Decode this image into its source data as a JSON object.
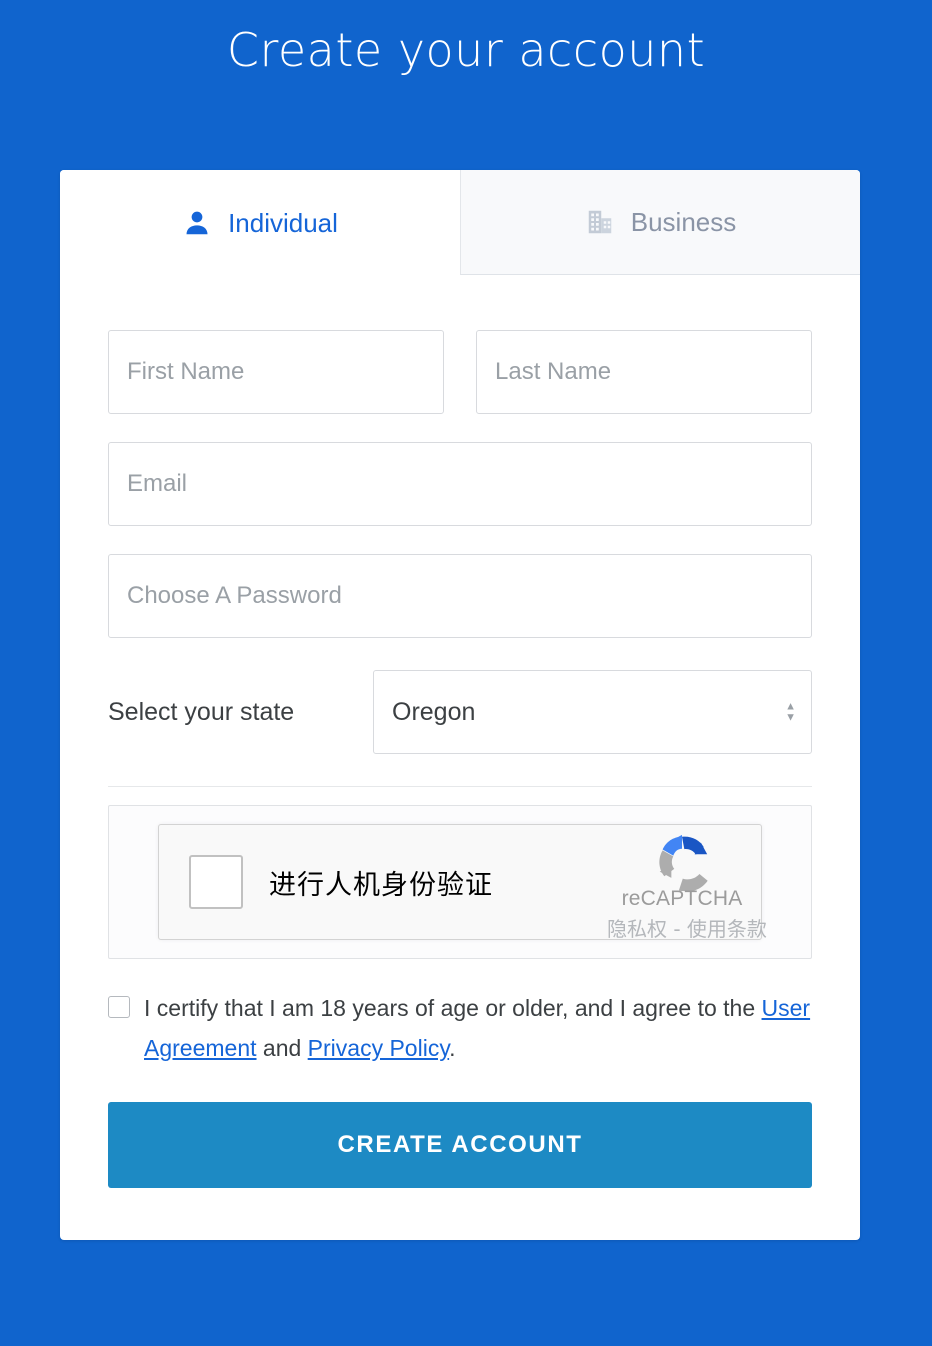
{
  "page": {
    "title": "Create your account",
    "background_color": "#1064cd"
  },
  "tabs": [
    {
      "id": "individual",
      "label": "Individual",
      "icon": "person-icon",
      "active": true,
      "color": "#1565d8"
    },
    {
      "id": "business",
      "label": "Business",
      "icon": "building-icon",
      "active": false,
      "color": "#8a94a6"
    }
  ],
  "form": {
    "first_name": {
      "placeholder": "First Name",
      "value": ""
    },
    "last_name": {
      "placeholder": "Last Name",
      "value": ""
    },
    "email": {
      "placeholder": "Email",
      "value": ""
    },
    "password": {
      "placeholder": "Choose A Password",
      "value": ""
    },
    "state": {
      "label": "Select your state",
      "selected": "Oregon",
      "options": [
        "Oregon"
      ]
    }
  },
  "captcha": {
    "checkbox_label": "进行人机身份验证",
    "brand_name": "reCAPTCHA",
    "terms": "隐私权 - 使用条款",
    "checked": false,
    "logo_icon": "recaptcha-logo-icon"
  },
  "certify": {
    "checked": false,
    "text_before": "I certify that I am 18 years of age or older, and I agree to the",
    "link_user_agreement": "User Agreement",
    "text_between": "and",
    "link_privacy_policy": "Privacy Policy",
    "text_after": "."
  },
  "submit": {
    "label": "CREATE ACCOUNT",
    "color": "#1d8ac4"
  }
}
